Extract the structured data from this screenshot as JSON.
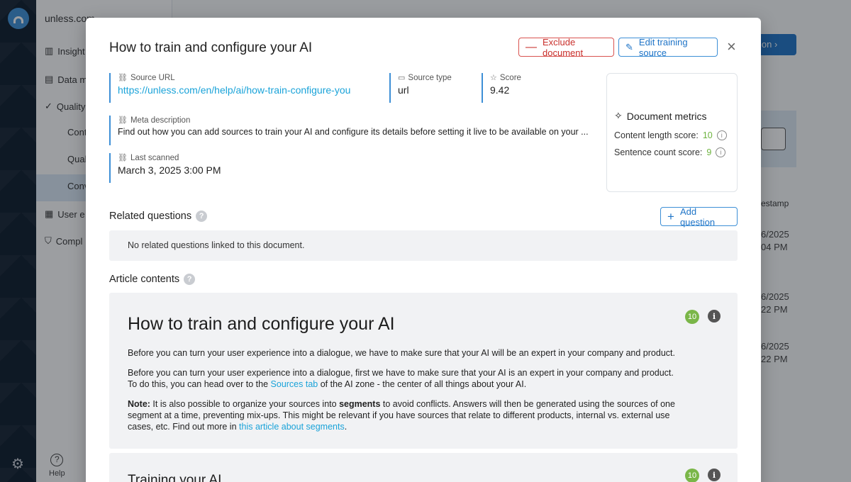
{
  "background": {
    "workspace": "unless.com",
    "nav": [
      {
        "label": "Insight",
        "icon": "chart-icon"
      },
      {
        "label": "Data m",
        "icon": "list-icon"
      },
      {
        "label": "Quality",
        "icon": "check-icon"
      },
      {
        "label": "User e",
        "icon": "grid-icon"
      },
      {
        "label": "Compl",
        "icon": "shield-icon"
      }
    ],
    "subnav": [
      "Cont",
      "Qual",
      "Conv"
    ],
    "help_label": "Help",
    "button_text": "ion",
    "column_header": "estamp",
    "timestamps": [
      {
        "date": "6/2025",
        "time": "04 PM"
      },
      {
        "date": "6/2025",
        "time": "22 PM"
      },
      {
        "date": "6/2025",
        "time": "22 PM"
      }
    ]
  },
  "modal": {
    "title": "How to train and configure your AI",
    "exclude_label": "Exclude document",
    "edit_label": "Edit training source",
    "close_glyph": "×",
    "fields": {
      "source_url_label": "Source URL",
      "source_url": "https://unless.com/en/help/ai/how-train-configure-you",
      "source_type_label": "Source type",
      "source_type": "url",
      "score_label": "Score",
      "score": "9.42",
      "meta_label": "Meta description",
      "meta": "Find out how you can add sources to train your AI and configure its details before setting it live to be available on your ...",
      "scanned_label": "Last scanned",
      "scanned": "March 3, 2025 3:00 PM"
    },
    "metrics": {
      "title": "Document metrics",
      "content_length_label": "Content length score:",
      "content_length": "10",
      "sentence_count_label": "Sentence count score:",
      "sentence_count": "9"
    },
    "related": {
      "heading": "Related questions",
      "add_label": "Add question",
      "empty": "No related questions linked to this document."
    },
    "article": {
      "heading": "Article contents",
      "h1": "How to train and configure your AI",
      "score": "10",
      "p1": "Before you can turn your user experience into a dialogue, we have to make sure that your AI will be an expert in your company and product.",
      "p2_before": "Before you can turn your user experience into a dialogue, first we have to make sure that your AI is an expert in your company and product. To do this, you can head over to the ",
      "p2_link": "Sources tab",
      "p2_after": " of the AI zone - the center of all things about your AI.",
      "p3_note": "Note:",
      "p3_a": " It is also possible to organize your sources into ",
      "p3_bold": "segments",
      "p3_b": " to avoid conflicts. Answers will then be generated using the sources of one segment at a time, preventing mix-ups. This might be relevant if you have sources that relate to different products, internal vs. external use cases, etc. Find out more in ",
      "p3_link": "this article about segments",
      "p3_end": ".",
      "h2": "Training your AI",
      "score2": "10"
    }
  }
}
